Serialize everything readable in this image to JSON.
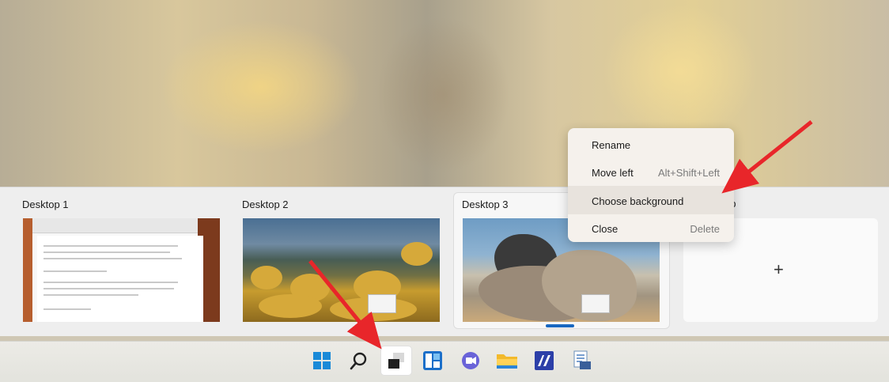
{
  "desktops": [
    {
      "label": "Desktop 1"
    },
    {
      "label": "Desktop 2"
    },
    {
      "label": "Desktop 3"
    }
  ],
  "desktop4_label_partial": "op",
  "new_desktop_symbol": "+",
  "context_menu": {
    "items": [
      {
        "label": "Rename",
        "shortcut": ""
      },
      {
        "label": "Move left",
        "shortcut": "Alt+Shift+Left"
      },
      {
        "label": "Choose background",
        "shortcut": ""
      },
      {
        "label": "Close",
        "shortcut": "Delete"
      }
    ],
    "highlighted": "Choose background"
  },
  "taskbar": {
    "icons": [
      "windows-start-icon",
      "search-icon",
      "task-view-icon",
      "widgets-icon",
      "teams-chat-icon",
      "file-explorer-icon",
      "word-press-icon",
      "app-icon"
    ]
  },
  "colors": {
    "accent": "#1867c0",
    "arrow": "#e8262a"
  }
}
